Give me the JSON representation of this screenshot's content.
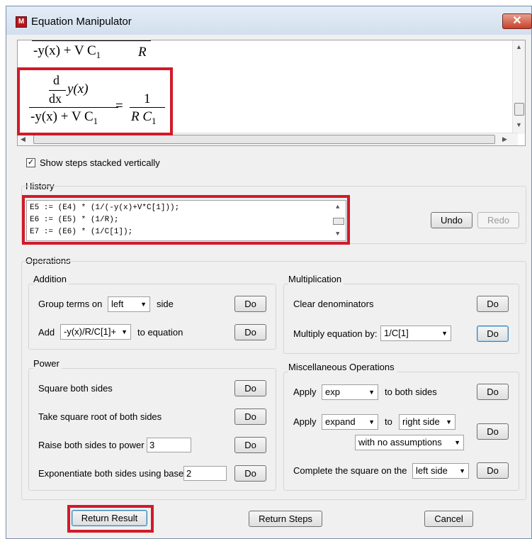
{
  "window": {
    "title": "Equation Manipulator",
    "icon": "maple-app-icon",
    "close": "✕"
  },
  "math": {
    "eq1": {
      "den_a": "-y(x) + V C",
      "sub": "1",
      "rhs": "R"
    },
    "eq2": {
      "num_d": "d",
      "num_dx": "dx",
      "num_y": "y(x)",
      "den_a": "-y(x) + V C",
      "sub": "1",
      "rhs_num": "1",
      "rhs_den": "R C",
      "rhs_sub": "1"
    }
  },
  "show_steps": {
    "label": "Show steps stacked vertically",
    "checked": true
  },
  "history": {
    "title": "History",
    "lines": [
      "E5 := (E4) * (1/(-y(x)+V*C[1]));",
      "E6 := (E5) * (1/R);",
      "E7 := (E6) * (1/C[1]);"
    ],
    "undo": "Undo",
    "redo": "Redo"
  },
  "operations": {
    "title": "Operations",
    "addition": {
      "title": "Addition",
      "group_label": "Group terms on",
      "group_value": "left",
      "group_suffix": "side",
      "add_label": "Add",
      "add_value": "-y(x)/R/C[1]+",
      "add_suffix": "to equation",
      "do": "Do"
    },
    "multiplication": {
      "title": "Multiplication",
      "clear_label": "Clear denominators",
      "multiply_label": "Multiply equation by:",
      "multiply_value": "1/C[1]",
      "do": "Do"
    },
    "power": {
      "title": "Power",
      "square_label": "Square both sides",
      "sqrt_label": "Take square root of both sides",
      "raise_label": "Raise both sides to power",
      "raise_value": "3",
      "exp_label": "Exponentiate both sides using base",
      "exp_value": "2",
      "do": "Do"
    },
    "misc": {
      "title": "Miscellaneous Operations",
      "apply_label": "Apply",
      "apply1_value": "exp",
      "apply1_suffix": "to both sides",
      "apply2_value": "expand",
      "to_label": "to",
      "side_value": "right side",
      "assumption_value": "with no assumptions",
      "complete_label": "Complete the square on the",
      "complete_value": "left side",
      "do": "Do"
    }
  },
  "footer": {
    "return_result": "Return Result",
    "return_steps": "Return Steps",
    "cancel": "Cancel"
  },
  "colors": {
    "highlight": "#d11a2a",
    "focus": "#3c7fb1"
  }
}
